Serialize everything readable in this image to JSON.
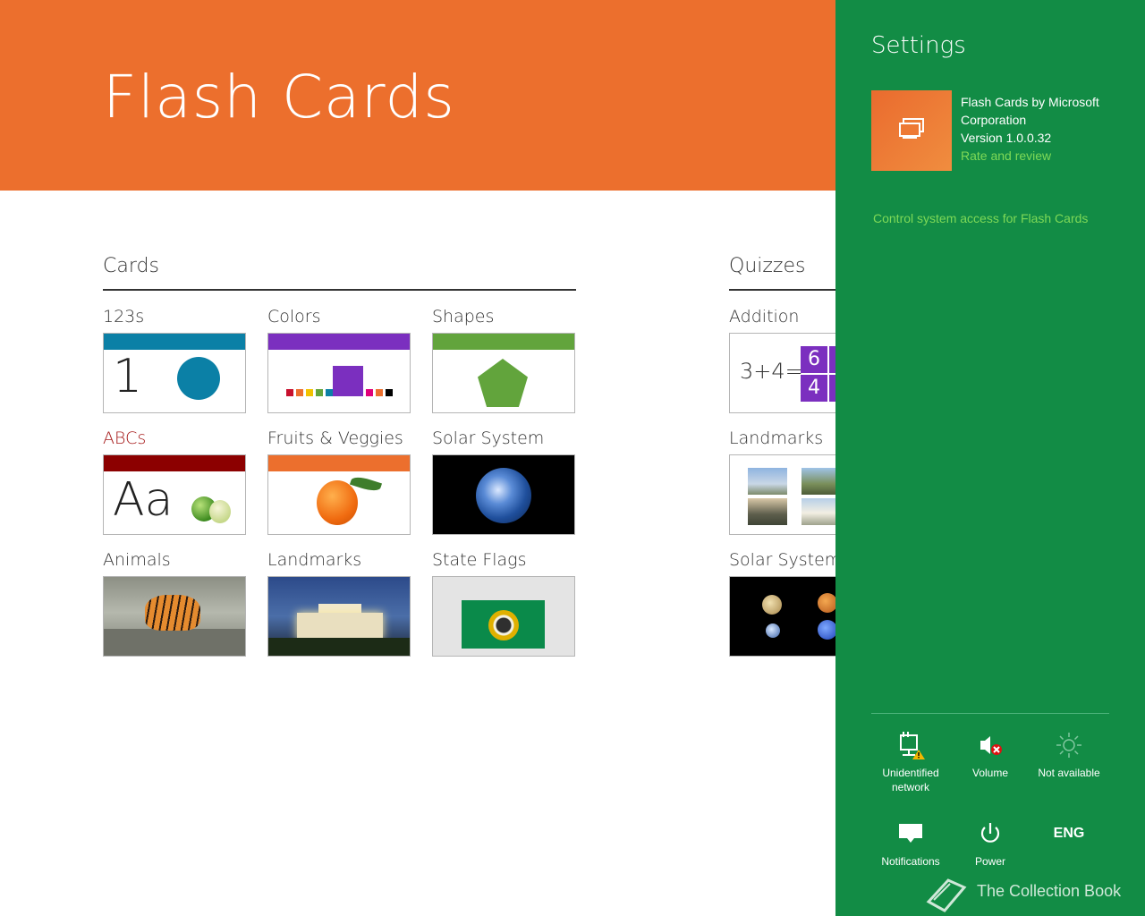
{
  "app": {
    "title": "Flash Cards"
  },
  "sections": {
    "cards": "Cards",
    "quizzes": "Quizzes"
  },
  "cards": [
    {
      "label": "123s",
      "band": "#0b80a6",
      "one": "1"
    },
    {
      "label": "Colors",
      "band": "#7b2fbf"
    },
    {
      "label": "Shapes",
      "band": "#62a43c"
    },
    {
      "label": "ABCs",
      "band": "#8c0000",
      "label_color": "#a51818",
      "aa": "Aa"
    },
    {
      "label": "Fruits & Veggies",
      "band": "#ec6f2d"
    },
    {
      "label": "Solar System"
    },
    {
      "label": "Animals"
    },
    {
      "label": "Landmarks"
    },
    {
      "label": "State Flags"
    }
  ],
  "quizzes": [
    {
      "label": "Addition",
      "expr": "3+4=",
      "box_top": "6",
      "box_bottom": "4"
    },
    {
      "label": "Landmarks"
    },
    {
      "label": "Solar System"
    }
  ],
  "colors_swatches": [
    "#c8102e",
    "#ec6f2d",
    "#f2c200",
    "#62a43c",
    "#0b80a6",
    "#7b2fbf",
    "#e0007a",
    "#ec6f2d",
    "#000000"
  ],
  "settings": {
    "title": "Settings",
    "app_name": "Flash Cards by Microsoft Corporation",
    "version": "Version 1.0.0.32",
    "rate_link": "Rate and review",
    "access_link": "Control system access for Flash Cards",
    "system": [
      {
        "label": "Unidentified network",
        "icon": "network-warning-icon"
      },
      {
        "label": "Volume",
        "icon": "volume-muted-icon"
      },
      {
        "label": "Not available",
        "icon": "brightness-icon"
      },
      {
        "label": "Notifications",
        "icon": "notifications-icon"
      },
      {
        "label": "Power",
        "icon": "power-icon"
      },
      {
        "label": "ENG",
        "icon": "keyboard-language"
      }
    ]
  },
  "watermark": "The Collection Book",
  "colors": {
    "header": "#ec6f2d",
    "settings_bg": "#128c45",
    "link": "#7ed957"
  }
}
